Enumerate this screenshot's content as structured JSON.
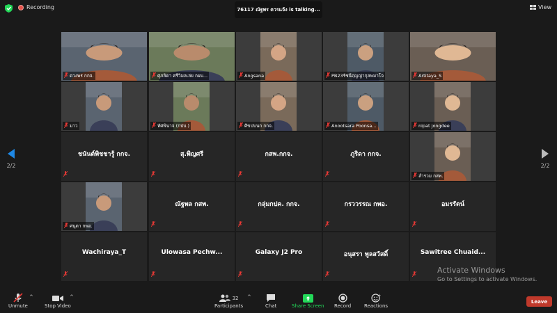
{
  "topbar": {
    "recording_label": "Recording",
    "talking_text": "76117 ณัฐพร ควรแจ้ง is  talking...",
    "view_label": "View"
  },
  "grid": {
    "tiles": [
      {
        "name": "ดวงพร กกจ.",
        "video": true
      },
      {
        "name": "ศุภลิตา ศรีวิมลเล่ย กผบ...",
        "video": true
      },
      {
        "name": "Angsana",
        "video": true
      },
      {
        "name": "PB23รัชนีฤญญ่ากุลพมาโจ",
        "video": true
      },
      {
        "name": "Artitaya_S",
        "video": true
      },
      {
        "name": "มาว",
        "video": true
      },
      {
        "name": "ทัศพินาจ (กปบ.)",
        "video": true
      },
      {
        "name": "ศิขปบนก กกจ.",
        "video": true
      },
      {
        "name": "Anootsara Poonsa...",
        "video": true
      },
      {
        "name": "nipat jongdee",
        "video": true
      },
      {
        "name": "ชนันต์พิชชารู้ กกจ.",
        "video": false
      },
      {
        "name": "สุ.พิญศรี",
        "video": false
      },
      {
        "name": "กสพ.กกจ.",
        "video": false
      },
      {
        "name": "ภูริดา กกจ.",
        "video": false
      },
      {
        "name": "ลำรวม กสพ.",
        "video": true
      },
      {
        "name": "ศนุตา กพอ.",
        "video": true
      },
      {
        "name": "ณัฐพล กสพ.",
        "video": false
      },
      {
        "name": "กลุ่มกปค. กกจ.",
        "video": false
      },
      {
        "name": "กรววรรณ  กพอ.",
        "video": false
      },
      {
        "name": "อมรรัตน์",
        "video": false
      },
      {
        "name": "Wachiraya_T",
        "video": false
      },
      {
        "name": "Ulowasa  Pechw...",
        "video": false
      },
      {
        "name": "Galaxy J2 Pro",
        "video": false
      },
      {
        "name": "อนุสรา พูลสวัสดิ์",
        "video": false
      },
      {
        "name": "Sawitree  Chuaid...",
        "video": false
      }
    ]
  },
  "nav": {
    "left_page": "2/2",
    "right_page": "2/2"
  },
  "watermark": {
    "line1": "Activate Windows",
    "line2": "Go to Settings to activate Windows."
  },
  "toolbar": {
    "unmute": "Unmute",
    "stop_video": "Stop Video",
    "participants": "Participants",
    "participants_count": "32",
    "chat": "Chat",
    "share_screen": "Share Screen",
    "record": "Record",
    "reactions": "Reactions",
    "leave": "Leave"
  },
  "colors": {
    "accent": "#1e88e5",
    "share_green": "#23d959",
    "leave_red": "#c0392b",
    "mute_red": "#e53935",
    "recording_red": "#e5534b"
  }
}
